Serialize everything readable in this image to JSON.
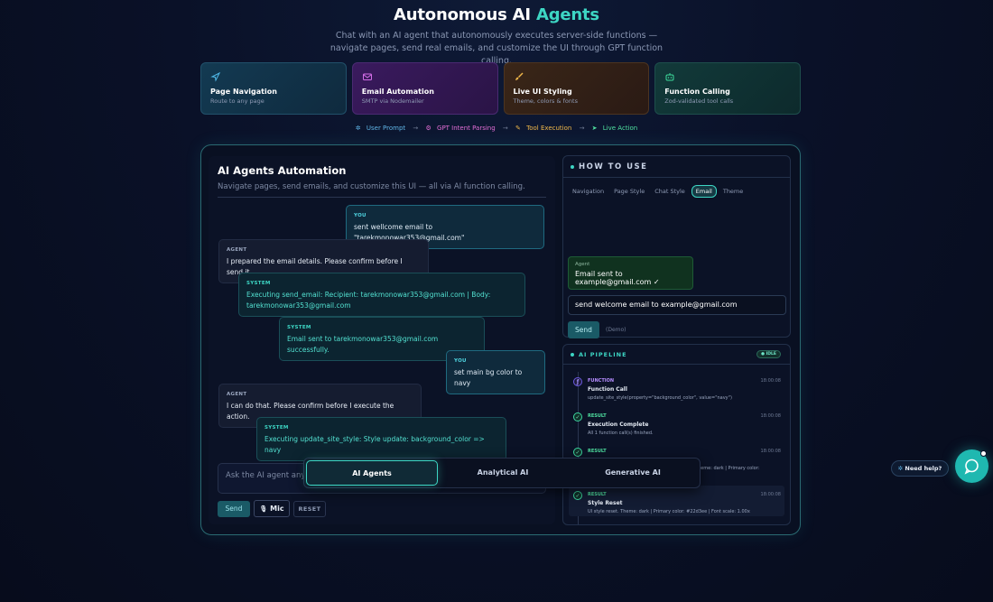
{
  "hero": {
    "title_main": "Autonomous AI ",
    "title_accent": "Agents",
    "subtitle": "Chat with an AI agent that autonomously executes server-side functions — navigate pages, send real emails, and customize the UI through GPT function calling."
  },
  "features": [
    {
      "title": "Page Navigation",
      "sub": "Route to any page",
      "icon": "navigation-arrow-icon"
    },
    {
      "title": "Email Automation",
      "sub": "SMTP via Nodemailer",
      "icon": "mail-icon"
    },
    {
      "title": "Live UI Styling",
      "sub": "Theme, colors & fonts",
      "icon": "paint-brush-icon"
    },
    {
      "title": "Function Calling",
      "sub": "Zod-validated tool calls",
      "icon": "robot-icon"
    }
  ],
  "flow": {
    "step1": "User Prompt",
    "step2": "GPT Intent Parsing",
    "step3": "Tool Execution",
    "step4": "Live Action",
    "arrow": "→"
  },
  "chat": {
    "title": "AI Agents Automation",
    "subtitle": "Navigate pages, send emails, and customize this UI — all via AI function calling.",
    "messages": [
      {
        "role": "YOU",
        "text": "sent wellcome email to \"tarekmonowar353@gmail.com\""
      },
      {
        "role": "AGENT",
        "text": "I prepared the email details. Please confirm before I send it."
      },
      {
        "role": "SYSTEM",
        "text": "Executing send_email: Recipient: tarekmonowar353@gmail.com | Body: tarekmonowar353@gmail.com"
      },
      {
        "role": "SYSTEM",
        "text": "Email sent to tarekmonowar353@gmail.com successfully."
      },
      {
        "role": "YOU",
        "text": "set main bg color to navy"
      },
      {
        "role": "AGENT",
        "text": "I can do that. Please confirm before I execute the action."
      },
      {
        "role": "SYSTEM",
        "text": "Executing update_site_style: Style update: background_color => navy"
      }
    ],
    "input_placeholder": "Ask the AI agent anyt",
    "send_label": "Send",
    "mic_label": "Mic",
    "reset_label": "RESET"
  },
  "bottom_tabs": [
    "AI Agents",
    "Analytical AI",
    "Generative AI"
  ],
  "howto": {
    "title": "HOW TO USE",
    "tabs": [
      "Navigation",
      "Page Style",
      "Chat Style",
      "Email",
      "Theme"
    ],
    "active_tab": "Email",
    "demo_role": "Agent",
    "demo_reply": "Email sent to example@gmail.com ✓",
    "demo_input": "send welcome email to example@gmail.com",
    "demo_send": "Send",
    "demo_note": "(Demo)"
  },
  "pipeline": {
    "title": "AI PIPELINE",
    "status": "● IDLE",
    "steps": [
      {
        "kind": "FUNCTION",
        "time": "18:00:08",
        "name": "Function Call",
        "detail": "update_site_style(property=\"background_color\", value=\"navy\")"
      },
      {
        "kind": "RESULT",
        "time": "18:00:08",
        "name": "Execution Complete",
        "detail": "All 1 function call(s) finished."
      },
      {
        "kind": "RESULT",
        "time": "18:00:08",
        "name": "",
        "detail": "heme: dark | Primary color:"
      },
      {
        "kind": "RESULT",
        "time": "18:00:08",
        "name": "Style Reset",
        "detail": "UI style reset. Theme: dark | Primary color: #22d3ee | Font scale: 1.00x"
      }
    ]
  },
  "help": {
    "label": "Need help?"
  },
  "colors": {
    "accent": "#3dd6c4",
    "background": "#0a1128"
  }
}
